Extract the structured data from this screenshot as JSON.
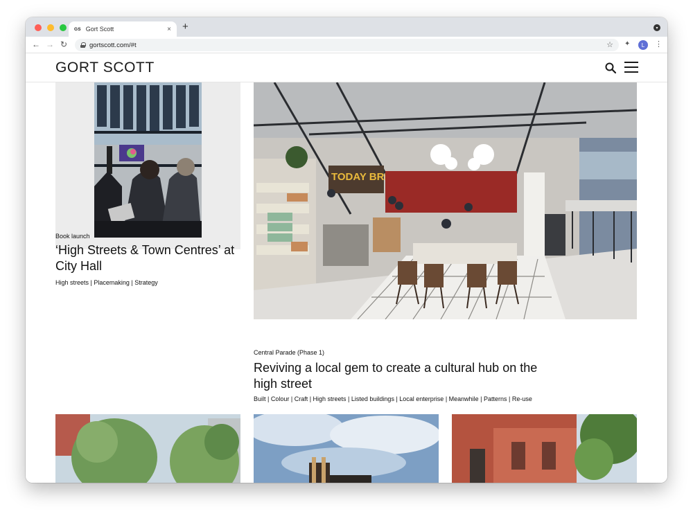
{
  "browser": {
    "tab": {
      "favicon": "GS",
      "title": "Gort Scott",
      "close_glyph": "×"
    },
    "new_tab_glyph": "+",
    "profile_menu_glyph": "▾",
    "toolbar": {
      "back": "←",
      "forward": "→",
      "reload": "↻",
      "url": "gortscott.com/#t",
      "star": "☆",
      "extensions": "✦",
      "avatar_initial": "L",
      "menu": "⋮"
    },
    "traffic_light_colors": [
      "#ff5f57",
      "#febc2e",
      "#28c840"
    ]
  },
  "site": {
    "logo": "GORT SCOTT",
    "icons": [
      "search-icon",
      "hamburger-menu-icon"
    ],
    "cards": [
      {
        "category": "Book launch",
        "title": "‘High Streets & Town Centres’ at City Hall",
        "tags": "High streets | Placemaking | Strategy"
      },
      {
        "category": "Central Parade (Phase 1)",
        "title": "Reviving a local gem to create a cultural hub on the high street",
        "tags": "Built | Colour | Craft | High streets | Listed buildings | Local enterprise | Meanwhile | Patterns | Re-use"
      }
    ],
    "image_sign_text": "TODAY BREAD"
  }
}
